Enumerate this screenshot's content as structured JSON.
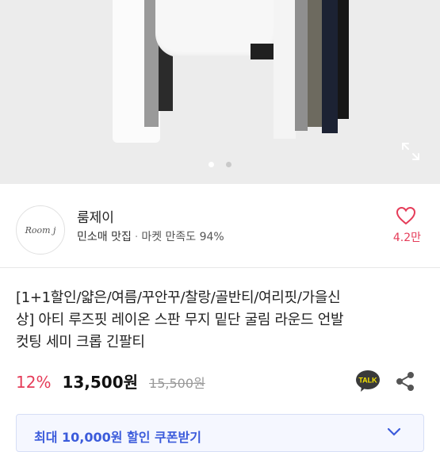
{
  "image": {
    "dots_count": 2,
    "active_dot": 0,
    "expand_icon": "expand-icon"
  },
  "seller": {
    "avatar_text": "Room j",
    "name": "룸제이",
    "badge": "민소매 맛집",
    "separator": "·",
    "satisfaction": "마켓 만족도 94%",
    "like_icon": "heart-icon",
    "like_count": "4.2만"
  },
  "product": {
    "title_lines": [
      "[1+1할인/얇은/여름/꾸안꾸/찰랑/골반티/여리핏/가을신",
      "상] 아티 루즈핏 레이온 스판 무지 밑단 굴림 라운드 언발",
      "컷팅 세미 크롭 긴팔티"
    ],
    "discount": "12%",
    "price": "13,500원",
    "original_price": "15,500원",
    "talk_label": "TALK",
    "share_icon": "share-icon"
  },
  "coupon": {
    "label": "최대 10,000원 할인 쿠폰받기",
    "chevron_icon": "chevron-down-icon"
  },
  "colors": {
    "accent_red": "#e53c59",
    "coupon_blue": "#3b5bdb",
    "talk_yellow": "#3a3a3a"
  }
}
